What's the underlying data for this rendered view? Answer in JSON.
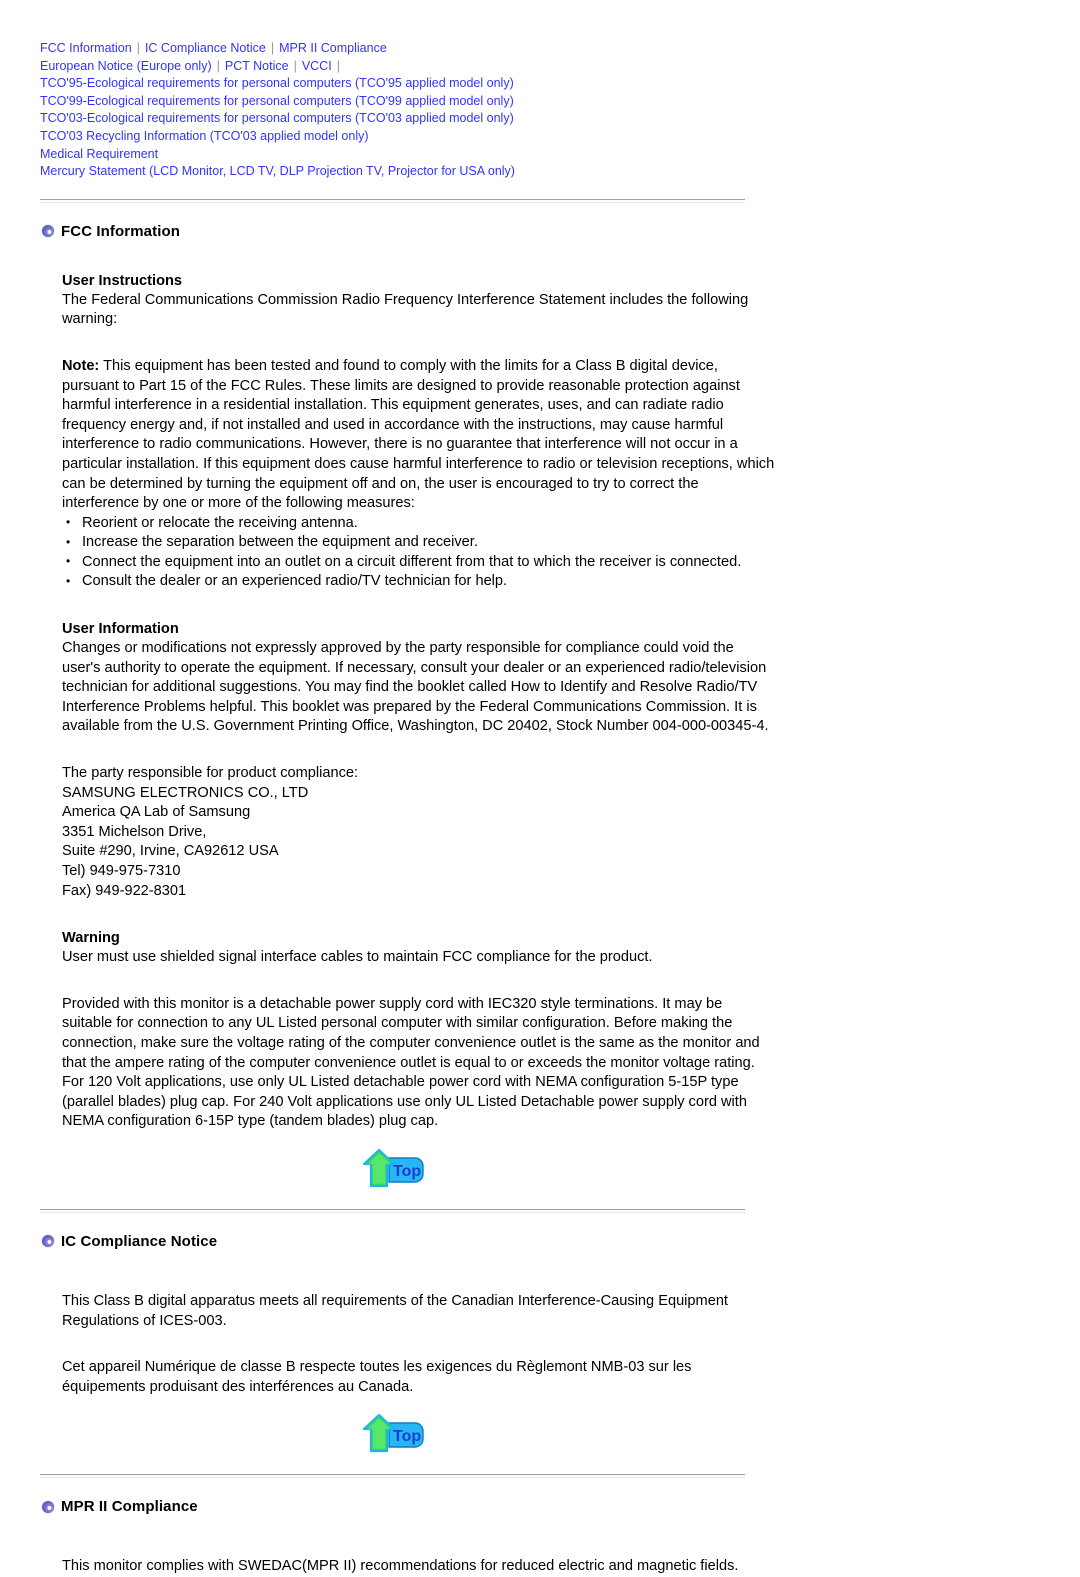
{
  "nav": {
    "separator": "|",
    "rows": [
      {
        "links": [
          "FCC Information",
          "IC Compliance Notice",
          "MPR II Compliance"
        ],
        "trailing_sep": false
      },
      {
        "links": [
          "European Notice (Europe only)",
          "PCT Notice",
          "VCCI"
        ],
        "trailing_sep": true
      },
      {
        "links": [
          "TCO'95-Ecological requirements for personal computers (TCO'95 applied model only)"
        ],
        "trailing_sep": false
      },
      {
        "links": [
          "TCO'99-Ecological requirements for personal computers (TCO'99 applied model only)"
        ],
        "trailing_sep": false
      },
      {
        "links": [
          "TCO'03-Ecological requirements for personal computers (TCO'03 applied model only)"
        ],
        "trailing_sep": false
      },
      {
        "links": [
          "TCO'03 Recycling Information (TCO'03 applied model only)"
        ],
        "trailing_sep": false
      },
      {
        "links": [
          "Medical Requirement"
        ],
        "trailing_sep": false
      },
      {
        "links": [
          "Mercury Statement (LCD Monitor, LCD TV, DLP Projection TV, Projector for USA only)"
        ],
        "trailing_sep": false
      }
    ],
    "link_color": "#3333ff",
    "separator_color": "#999999"
  },
  "sections": {
    "fcc": {
      "heading": "FCC Information",
      "user_instructions_head": "User Instructions",
      "user_instructions_body": "The Federal Communications Commission Radio Frequency Interference Statement includes the following warning:",
      "note_label": "Note:",
      "note_body": " This equipment has been tested and found to comply with the limits for a Class B digital device, pursuant to Part 15 of the FCC Rules. These limits are designed to provide reasonable protection against harmful interference in a residential installation. This equipment generates, uses, and can radiate radio frequency energy and, if not installed and used in accordance with the instructions, may cause harmful interference to radio communications. However, there is no guarantee that interference will not occur in a particular installation. If this equipment does cause harmful interference to radio or television receptions, which can be determined by turning the equipment off and on, the user is encouraged to try to correct the interference by one or more of the following measures:",
      "measures": [
        "Reorient or relocate the receiving antenna.",
        "Increase the separation between the equipment and receiver.",
        "Connect the equipment into an outlet on a circuit different from that to which the receiver is connected.",
        "Consult the dealer or an experienced radio/TV technician for help."
      ],
      "user_information_head": "User Information",
      "user_information_body": "Changes or modifications not expressly approved by the party responsible for compliance could void the user's authority to operate the equipment. If necessary, consult your dealer or an experienced radio/television technician for additional suggestions. You may find the booklet called How to Identify and Resolve Radio/TV Interference Problems helpful. This booklet was prepared by the Federal Communications Commission. It is available from the U.S. Government Printing Office, Washington, DC 20402, Stock Number 004-000-00345-4.",
      "contact_lines": [
        "The party responsible for product compliance:",
        "SAMSUNG ELECTRONICS CO., LTD",
        "America QA Lab of Samsung",
        "3351 Michelson Drive,",
        "Suite #290, Irvine, CA92612 USA",
        "Tel) 949-975-7310",
        "Fax) 949-922-8301"
      ],
      "warning_head": "Warning",
      "warning_body": "User must use shielded signal interface cables to maintain FCC compliance for the product.",
      "power_cord_body": "Provided with this monitor is a detachable power supply cord with IEC320 style terminations. It may be suitable for connection to any UL Listed personal computer with similar configuration. Before making the connection, make sure the voltage rating of the computer convenience outlet is the same as the monitor and that the ampere rating of the computer convenience outlet is equal to or exceeds the monitor voltage rating.",
      "nema_body": "For 120 Volt applications, use only UL Listed detachable power cord with NEMA configuration 5-15P type (parallel blades) plug cap. For 240 Volt applications use only UL Listed Detachable power supply cord with NEMA configuration 6-15P type (tandem blades) plug cap."
    },
    "ic": {
      "heading": "IC Compliance Notice",
      "paragraph_en": "This Class B digital apparatus meets all requirements of the Canadian Interference-Causing Equipment Regulations of ICES-003.",
      "paragraph_fr": "Cet appareil Numérique de classe B respecte toutes les exigences du Règlemont NMB-03 sur les équipements produisant des interférences au Canada."
    },
    "mpr": {
      "heading": "MPR II Compliance",
      "paragraph": "This monitor complies with SWEDAC(MPR II) recommendations for reduced electric and magnetic fields."
    }
  },
  "top_button": {
    "label": "Top",
    "icon": "arrow-up-top-icon",
    "arrow_color": "#22cc44",
    "text_color": "#1a4fe0",
    "badge_color": "#29b6f6"
  }
}
